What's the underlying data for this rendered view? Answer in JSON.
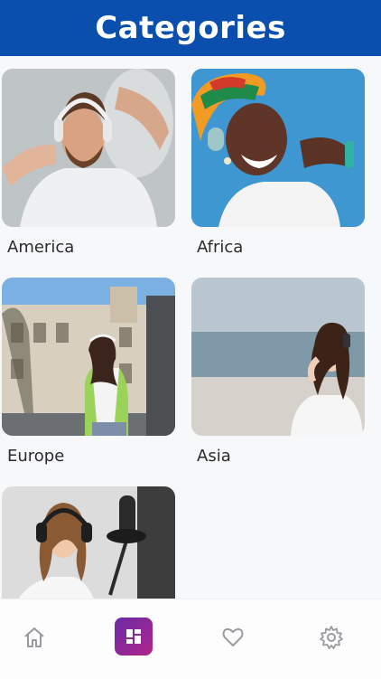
{
  "header": {
    "title": "Categories"
  },
  "categories": [
    {
      "label": "America"
    },
    {
      "label": "Africa"
    },
    {
      "label": "Europe"
    },
    {
      "label": "Asia"
    },
    {
      "label": ""
    }
  ],
  "tabbar": {
    "items": [
      {
        "name": "home-icon",
        "active": false
      },
      {
        "name": "grid-icon",
        "active": true
      },
      {
        "name": "heart-icon",
        "active": false
      },
      {
        "name": "gear-icon",
        "active": false
      }
    ]
  },
  "colors": {
    "header_bg": "#0a4fae",
    "active_tab_gradient_start": "#6a2aa8",
    "active_tab_gradient_end": "#b0258a",
    "icon_gray": "#9a9aa0"
  }
}
